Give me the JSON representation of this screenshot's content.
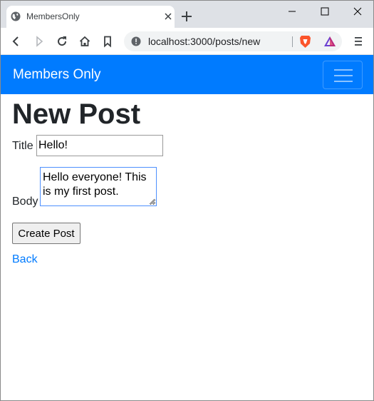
{
  "browser": {
    "tab": {
      "title": "MembersOnly",
      "favicon": "globe-icon"
    },
    "window_controls": [
      "minimize-icon",
      "maximize-icon",
      "close-icon"
    ],
    "toolbar_icons": [
      "back-arrow-icon",
      "forward-arrow-icon",
      "reload-icon",
      "home-icon",
      "bookmark-icon",
      "info-icon",
      "brave-shields-icon",
      "brave-rewards-icon",
      "menu-icon"
    ],
    "address_bar": {
      "url": "localhost:3000/posts/new"
    }
  },
  "navbar": {
    "brand": "Members Only",
    "background": "#007bff",
    "toggler_icon": "hamburger-icon"
  },
  "page": {
    "heading": "New Post",
    "form": {
      "title_label": "Title",
      "title_value": "Hello!",
      "body_label": "Body",
      "body_value": "Hello everyone! This is my first post.",
      "submit_label": "Create Post"
    },
    "back_link": "Back",
    "link_color": "#007bff"
  }
}
